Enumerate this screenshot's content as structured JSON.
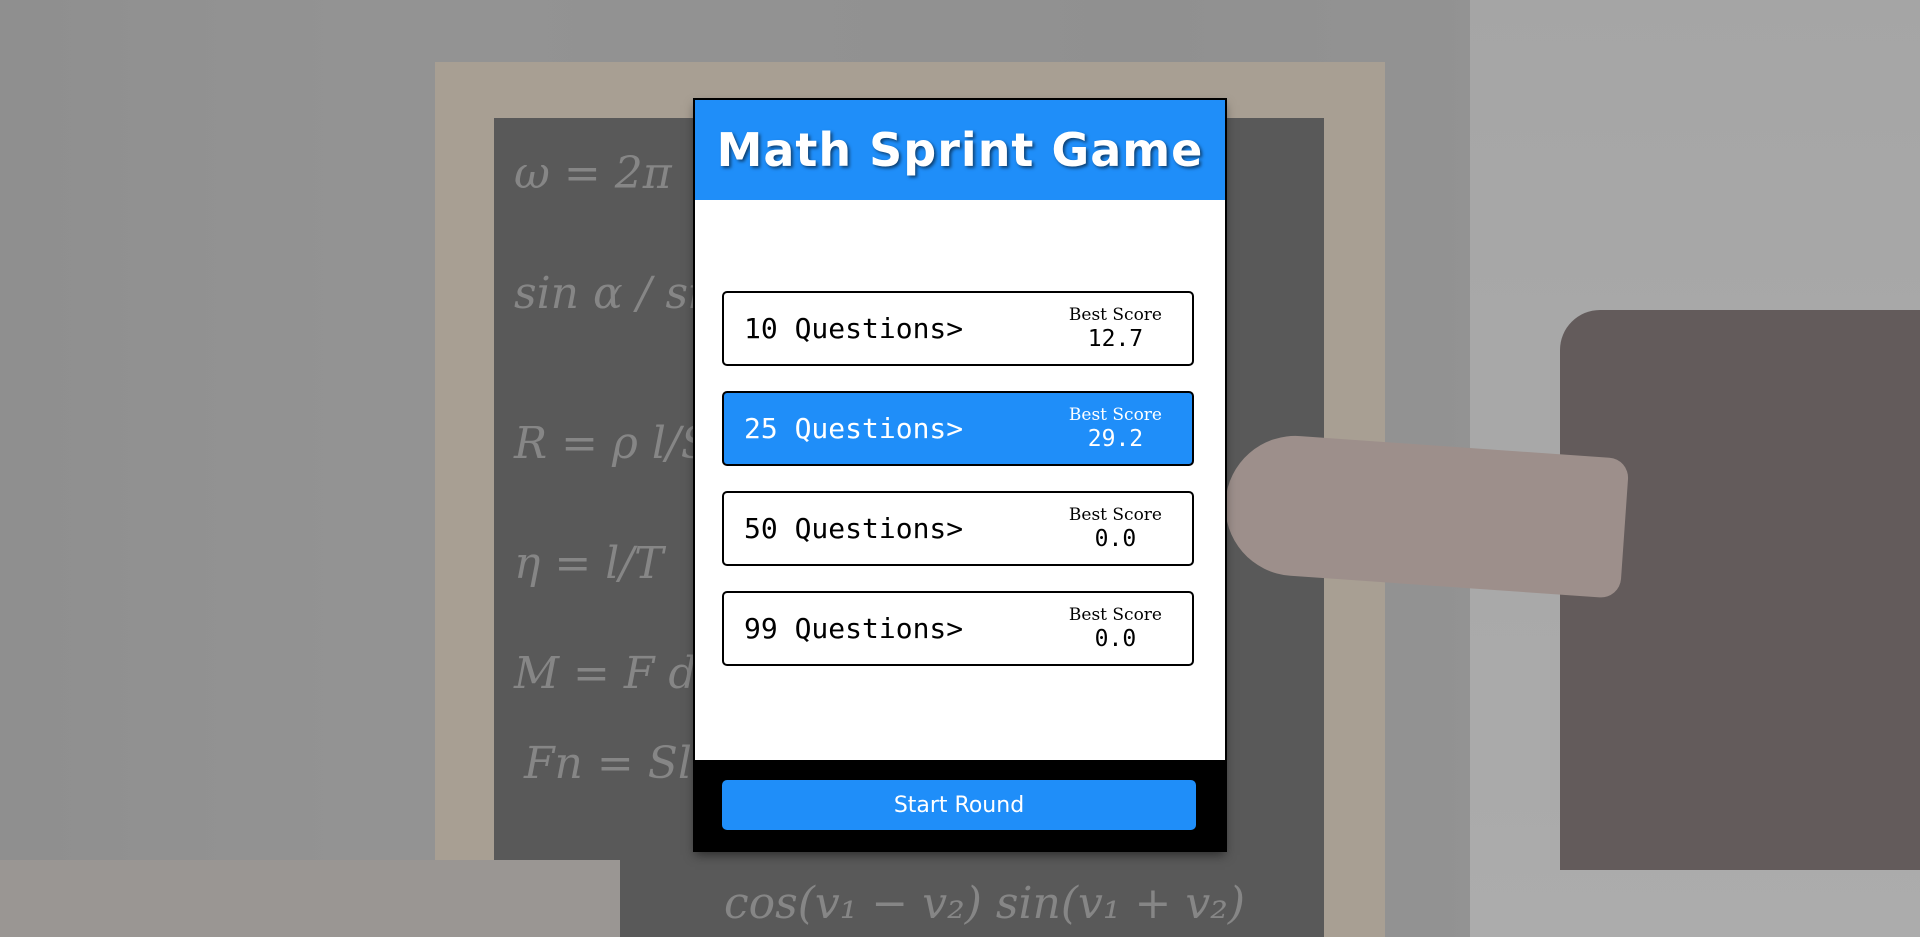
{
  "game": {
    "title": "Math Sprint Game"
  },
  "options": [
    {
      "label": "10 Questions>",
      "score_title": "Best Score",
      "score": "12.7",
      "selected": false
    },
    {
      "label": "25 Questions>",
      "score_title": "Best Score",
      "score": "29.2",
      "selected": true
    },
    {
      "label": "50 Questions>",
      "score_title": "Best Score",
      "score": "0.0",
      "selected": false
    },
    {
      "label": "99 Questions>",
      "score_title": "Best Score",
      "score": "0.0",
      "selected": false
    }
  ],
  "footer": {
    "start_label": "Start Round"
  },
  "colors": {
    "accent": "#1f8ef9",
    "footer": "#000000",
    "card": "#ffffff"
  }
}
